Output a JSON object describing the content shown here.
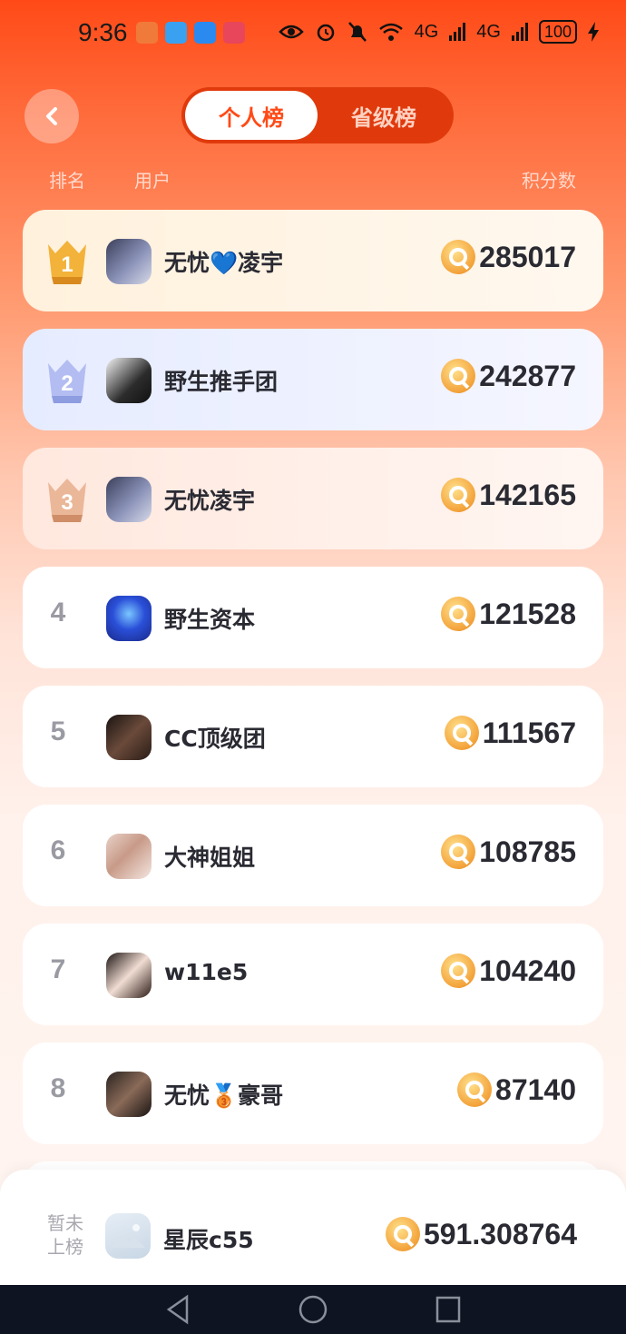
{
  "status_bar": {
    "time": "9:36",
    "network_1": "4G",
    "network_2": "4G",
    "battery": "100",
    "icons": [
      "eye-icon",
      "alarm-icon",
      "mute-icon",
      "wifi-icon",
      "signal-icon",
      "charging-icon"
    ]
  },
  "header": {
    "tabs": [
      {
        "label": "个人榜",
        "active": true
      },
      {
        "label": "省级榜",
        "active": false
      }
    ]
  },
  "columns": {
    "rank": "排名",
    "user": "用户",
    "score": "积分数"
  },
  "colors": {
    "accent": "#ff4a17",
    "gold": "#f3a23a",
    "silver": "#9aa6e8",
    "bronze": "#e2a27e"
  },
  "leaderboard": [
    {
      "rank": "1",
      "name": "无忧💙凌宇",
      "score": "285017"
    },
    {
      "rank": "2",
      "name": "野生推手团",
      "score": "242877"
    },
    {
      "rank": "3",
      "name": "无忧凌宇",
      "score": "142165"
    },
    {
      "rank": "4",
      "name": "野生资本",
      "score": "121528"
    },
    {
      "rank": "5",
      "name": "CC顶级团",
      "score": "111567"
    },
    {
      "rank": "6",
      "name": "大神姐姐",
      "score": "108785"
    },
    {
      "rank": "7",
      "name": "w11e5",
      "score": "104240"
    },
    {
      "rank": "8",
      "name": "无忧🥉豪哥",
      "score": "87140"
    }
  ],
  "my_rank": {
    "status": "暂未上榜",
    "name": "星辰c55",
    "score": "591.308764"
  }
}
